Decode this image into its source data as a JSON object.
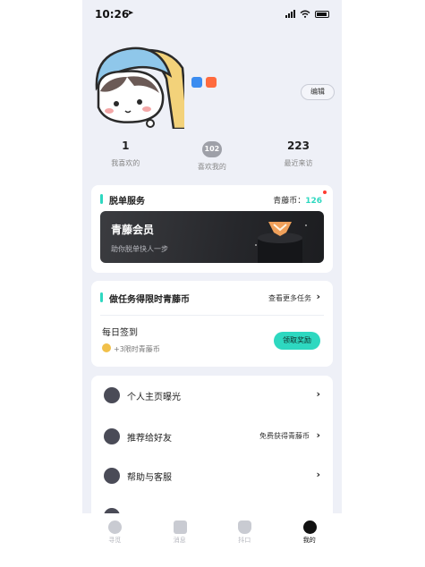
{
  "status_bar": {
    "time": "10:26"
  },
  "header": {
    "edit_label": "编辑"
  },
  "stats": [
    {
      "value": "1",
      "label": "我喜欢的"
    },
    {
      "value": "102",
      "label": "喜欢我的"
    },
    {
      "value": "223",
      "label": "最近来访"
    }
  ],
  "service": {
    "title": "脱单服务",
    "coin_label": "青藤币：",
    "coin_value": "126",
    "vip_title": "青藤会员",
    "vip_subtitle": "助你脱单快人一步"
  },
  "tasks": {
    "title": "做任务得限时青藤币",
    "more_label": "查看更多任务",
    "checkin_title": "每日签到",
    "checkin_reward": "+3限时青藤币",
    "claim_label": "领取奖励"
  },
  "menu": [
    {
      "label": "个人主页曝光",
      "right": ""
    },
    {
      "label": "推荐给好友",
      "right": "免费获得青藤币"
    },
    {
      "label": "帮助与客服",
      "right": ""
    }
  ],
  "tabs": [
    {
      "label": "寻觅",
      "icon": "discover-icon"
    },
    {
      "label": "消息",
      "icon": "message-icon"
    },
    {
      "label": "抖口",
      "icon": "dynamic-icon"
    },
    {
      "label": "我的",
      "icon": "profile-icon"
    }
  ],
  "colors": {
    "accent": "#2ed8c0",
    "background": "#eef0f7"
  }
}
